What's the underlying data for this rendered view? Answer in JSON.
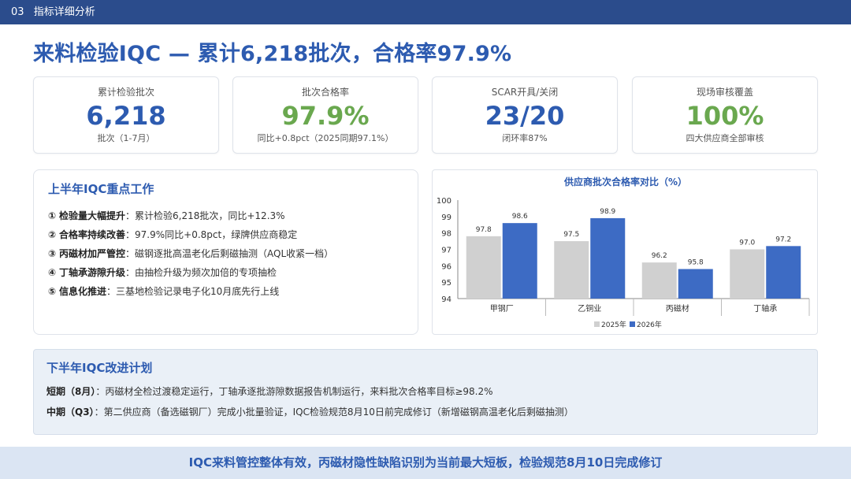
{
  "header": {
    "section_num": "03",
    "section_title": "指标详细分析"
  },
  "title": "来料检验IQC — 累计6,218批次，合格率97.9%",
  "kpis": [
    {
      "label": "累计检验批次",
      "value": "6,218",
      "sub": "批次（1-7月）",
      "color": "#2d5bb0"
    },
    {
      "label": "批次合格率",
      "value": "97.9%",
      "sub": "同比+0.8pct（2025同期97.1%）",
      "color": "#6aa84f"
    },
    {
      "label": "SCAR开具/关闭",
      "value": "23/20",
      "sub": "闭环率87%",
      "color": "#2d5bb0"
    },
    {
      "label": "现场审核覆盖",
      "value": "100%",
      "sub": "四大供应商全部审核",
      "color": "#6aa84f"
    }
  ],
  "work": {
    "title": "上半年IQC重点工作",
    "items": [
      {
        "num": "①",
        "head": "检验量大幅提升",
        "text": "：累计检验6,218批次，同比+12.3%"
      },
      {
        "num": "②",
        "head": "合格率持续改善",
        "text": "：97.9%同比+0.8pct，绿牌供应商稳定"
      },
      {
        "num": "③",
        "head": "丙磁材加严管控",
        "text": "：磁钢逐批高温老化后剩磁抽测（AQL收紧一档）"
      },
      {
        "num": "④",
        "head": "丁轴承游隙升级",
        "text": "：由抽检升级为频次加倍的专项抽检"
      },
      {
        "num": "⑤",
        "head": "信息化推进",
        "text": "：三基地检验记录电子化10月底先行上线"
      }
    ]
  },
  "chart_data": {
    "type": "bar",
    "title": "供应商批次合格率对比（%）",
    "categories": [
      "甲钢厂",
      "乙铜业",
      "丙磁材",
      "丁轴承"
    ],
    "series": [
      {
        "name": "2025年",
        "values": [
          97.8,
          97.5,
          96.2,
          97.0
        ],
        "color": "#d0d0d0"
      },
      {
        "name": "2026年",
        "values": [
          98.6,
          98.9,
          95.8,
          97.2
        ],
        "color": "#3d6bc4"
      }
    ],
    "ylim": [
      94,
      100
    ],
    "yticks": [
      94,
      95,
      96,
      97,
      98,
      99,
      100
    ],
    "legend": "bottom"
  },
  "plan": {
    "title": "下半年IQC改进计划",
    "rows": [
      {
        "tag": "短期（8月）",
        "text": "：丙磁材全检过渡稳定运行，丁轴承逐批游隙数据报告机制运行，来料批次合格率目标≥98.2%"
      },
      {
        "tag": "中期（Q3）",
        "text": "：第二供应商（备选磁钢厂）完成小批量验证，IQC检验规范8月10日前完成修订（新增磁钢高温老化后剩磁抽测）"
      }
    ]
  },
  "footer": "IQC来料管控整体有效，丙磁材隐性缺陷识别为当前最大短板，检验规范8月10日完成修订"
}
